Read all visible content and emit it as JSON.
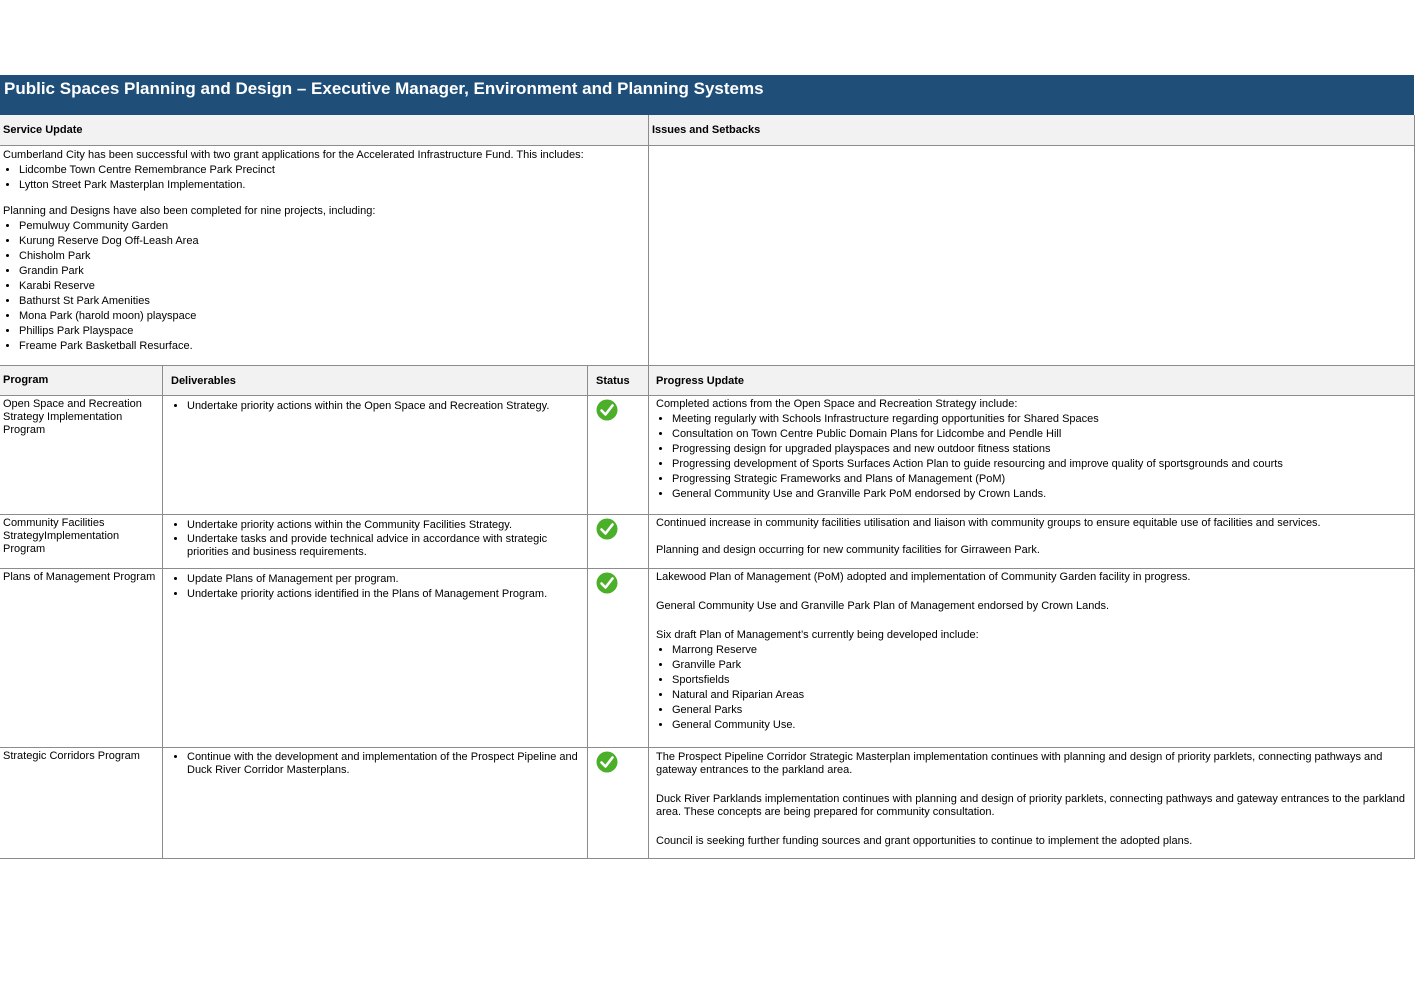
{
  "title": "Public Spaces Planning and Design – Executive Manager, Environment and Planning Systems",
  "headers": {
    "service_update": "Service Update",
    "issues": "Issues and Setbacks",
    "program": "Program",
    "deliverables": "Deliverables",
    "status": "Status",
    "progress": "Progress Update"
  },
  "service_update": {
    "intro1": "Cumberland City has been successful with two grant applications for the Accelerated Infrastructure Fund. This includes:",
    "list1": [
      "Lidcombe Town Centre Remembrance Park Precinct",
      "Lytton Street Park Masterplan Implementation."
    ],
    "intro2": "Planning and Designs have also been completed for nine projects, including:",
    "list2": [
      "Pemulwuy Community Garden",
      "Kurung Reserve Dog Off-Leash Area",
      "Chisholm Park",
      "Grandin Park",
      "Karabi Reserve",
      "Bathurst St Park Amenities",
      "Mona Park (harold moon) playspace",
      "Phillips Park Playspace",
      "Freame Park Basketball Resurface."
    ]
  },
  "issues_text": "",
  "status_color": "#4caf29",
  "programs": [
    {
      "name": "Open Space and Recreation Strategy Implementation Program",
      "deliverables": [
        "Undertake priority actions within the Open Space and Recreation Strategy."
      ],
      "status": "check-icon",
      "progress_intro": "Completed actions from the Open Space and Recreation Strategy include:",
      "progress_list": [
        "Meeting regularly with Schools Infrastructure regarding opportunities for Shared Spaces",
        "Consultation on Town Centre Public Domain Plans for Lidcombe and Pendle Hill",
        "Progressing design for upgraded playspaces and new outdoor fitness stations",
        "Progressing development of Sports Surfaces Action Plan to guide resourcing and improve quality of sportsgrounds and courts",
        "Progressing Strategic Frameworks and Plans of Management (PoM)",
        "General Community Use and Granville Park PoM endorsed by Crown Lands."
      ]
    },
    {
      "name": "Community Facilities StrategyImplementation Program",
      "deliverables": [
        "Undertake priority actions within the Community Facilities Strategy.",
        "Undertake tasks and provide technical advice in accordance with strategic priorities and business requirements."
      ],
      "status": "check-icon",
      "progress_p1": "Continued increase in community facilities utilisation and liaison with community groups to ensure equitable use of facilities and services.",
      "progress_p2": "Planning and design occurring for new community facilities for Girraween Park."
    },
    {
      "name": "Plans of Management Program",
      "deliverables": [
        "Update Plans of Management per program.",
        "Undertake priority actions identified in the Plans of Management Program."
      ],
      "status": "check-icon",
      "progress_p1": "Lakewood Plan of Management (PoM) adopted and implementation of Community Garden facility in progress.",
      "progress_p2": "General Community Use and Granville Park  Plan of Management endorsed by Crown Lands.",
      "progress_p3": "Six draft Plan of Management’s currently being developed include:",
      "progress_list": [
        "Marrong Reserve",
        "Granville Park",
        "Sportsfields",
        "Natural and Riparian Areas",
        "General Parks",
        "General Community Use."
      ]
    },
    {
      "name": "Strategic Corridors Program",
      "deliverables": [
        "Continue with the development and implementation of the Prospect Pipeline and Duck River Corridor Masterplans."
      ],
      "status": "check-icon",
      "progress_p1": "The Prospect Pipeline Corridor Strategic Masterplan implementation continues with planning and design of priority parklets, connecting pathways and gateway entrances to the parkland area.",
      "progress_p2": "Duck River Parklands implementation continues with planning and design of priority parklets, connecting pathways and gateway entrances to the parkland area. These concepts are being prepared for community consultation.",
      "progress_p3": "Council is seeking further funding sources and grant opportunities to continue to implement the adopted plans."
    }
  ]
}
